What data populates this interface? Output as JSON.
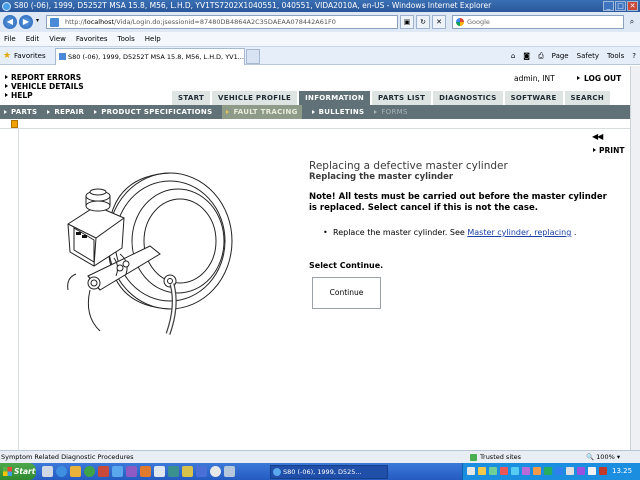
{
  "window": {
    "title": "S80 (-06), 1999, D5252T MSA 15.8, M56, L.H.D, YV1TS7202X1040551, 040551, VIDA2010A, en-US - Windows Internet Explorer"
  },
  "address_bar": {
    "url_prefix": "http://",
    "url_host": "localhost",
    "url_rest": "/Vida/Login.do;jsessionid=87480DB4864A2C35DAEAA078442A61F0",
    "search_placeholder": "Google"
  },
  "menu": [
    "File",
    "Edit",
    "View",
    "Favorites",
    "Tools",
    "Help"
  ],
  "favorites_bar": {
    "favorites_label": "Favorites",
    "tab_title": "S80 (-06), 1999, D5252T MSA 15.8, M56, L.H.D, YV1...",
    "commands": [
      "Page",
      "Safety",
      "Tools"
    ]
  },
  "vida": {
    "left_links": [
      "REPORT ERRORS",
      "VEHICLE DETAILS",
      "HELP"
    ],
    "user": "admin, INT",
    "logout": "LOG OUT",
    "top_tabs": [
      "START",
      "VEHICLE PROFILE",
      "INFORMATION",
      "PARTS LIST",
      "DIAGNOSTICS",
      "SOFTWARE",
      "SEARCH"
    ],
    "active_top_tab": "INFORMATION",
    "sub_nav": [
      "PARTS",
      "REPAIR",
      "PRODUCT SPECIFICATIONS",
      "FAULT TRACING",
      "BULLETINS",
      "FORMS"
    ],
    "nav_arrows": "◀◀",
    "print": "PRINT"
  },
  "content": {
    "heading": "Replacing a defective master cylinder",
    "subheading": "Replacing the master cylinder",
    "note": "Note! All tests must be carried out before the master cylinder is replaced. Select cancel if this is not the case.",
    "bullet_text": "Replace the master cylinder. See",
    "bullet_link": "Master cylinder, replacing",
    "bullet_end": ".",
    "instruction": "Select Continue.",
    "continue_label": "Continue"
  },
  "status_bar": {
    "left": "Symptom Related Diagnostic Procedures",
    "zone": "Trusted sites",
    "zoom": "100%"
  },
  "taskbar": {
    "start": "Start",
    "task": "S80 (-06), 1999, D525...",
    "clock": "13.25"
  },
  "colors": {
    "nav_dark": "#607277",
    "tab_light": "#dde4e2",
    "link": "#1a3fa8"
  }
}
